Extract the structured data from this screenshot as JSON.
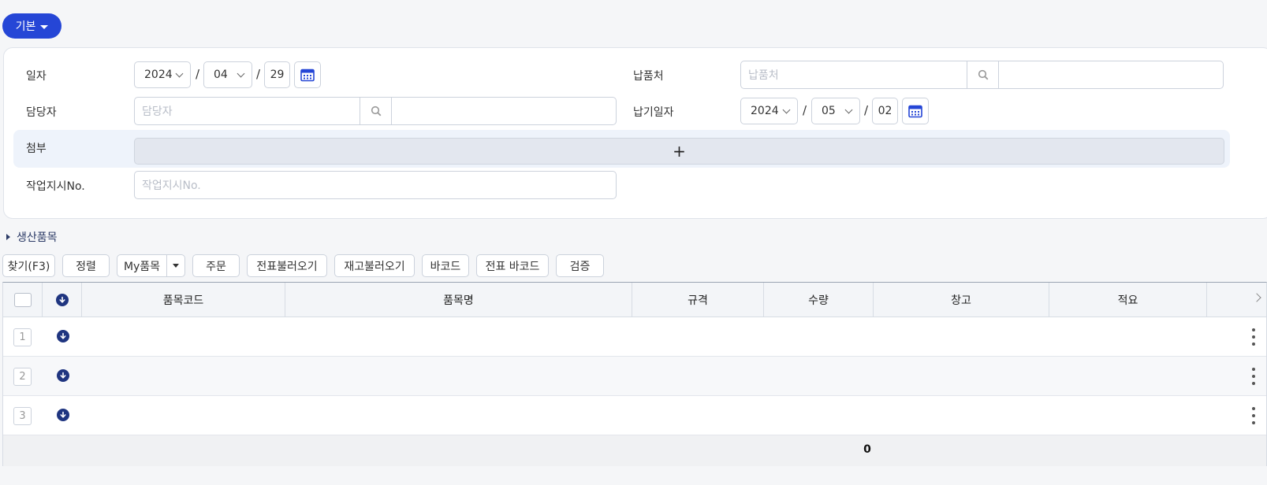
{
  "mode_button": {
    "label": "기본"
  },
  "form": {
    "date": {
      "label": "일자",
      "year": "2024",
      "month": "04",
      "day": "29",
      "sep": "/"
    },
    "delivery_place": {
      "label": "납품처",
      "placeholder": "납품처"
    },
    "manager": {
      "label": "담당자",
      "placeholder": "담당자"
    },
    "due_date": {
      "label": "납기일자",
      "year": "2024",
      "month": "05",
      "day": "02",
      "sep": "/"
    },
    "attachment": {
      "label": "첨부",
      "add_symbol": "+"
    },
    "work_order": {
      "label": "작업지시No.",
      "placeholder": "작업지시No."
    }
  },
  "section": {
    "title": "생산품목"
  },
  "toolbar": {
    "find": "찾기(F3)",
    "sort": "정렬",
    "my_items": "My품목",
    "order": "주문",
    "load_slip": "전표불러오기",
    "load_stock": "재고불러오기",
    "barcode": "바코드",
    "slip_barcode": "전표 바코드",
    "verify": "검증"
  },
  "grid": {
    "columns": [
      "품목코드",
      "품목명",
      "규격",
      "수량",
      "창고",
      "적요"
    ],
    "rows": [
      "1",
      "2",
      "3"
    ],
    "total_quantity": "0"
  },
  "colors": {
    "accent": "#2546d6",
    "icon_dark": "#1f3580"
  },
  "icons": [
    "caret-down-icon",
    "calendar-icon",
    "search-icon",
    "plus-icon",
    "download-circle-icon",
    "kebab-icon",
    "chevron-right-icon"
  ]
}
